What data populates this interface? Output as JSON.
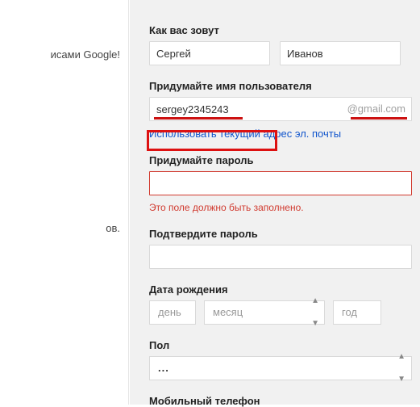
{
  "left": {
    "fragment1": "исами Google!",
    "fragment2": "ов."
  },
  "name_section": {
    "label": "Как вас зовут",
    "first_value": "Сергей",
    "last_value": "Иванов"
  },
  "username_section": {
    "label": "Придумайте имя пользователя",
    "value": "sergey2345243",
    "suffix": "@gmail.com",
    "use_existing_link": "Использовать текущий адрес эл. почты"
  },
  "password_section": {
    "label": "Придумайте пароль",
    "value": "",
    "error": "Это поле должно быть заполнено."
  },
  "confirm_section": {
    "label": "Подтвердите пароль",
    "value": ""
  },
  "dob_section": {
    "label": "Дата рождения",
    "day_placeholder": "день",
    "month_placeholder": "месяц",
    "year_placeholder": "год"
  },
  "gender_section": {
    "label": "Пол",
    "value": "..."
  },
  "phone_section": {
    "label": "Мобильный телефон"
  }
}
